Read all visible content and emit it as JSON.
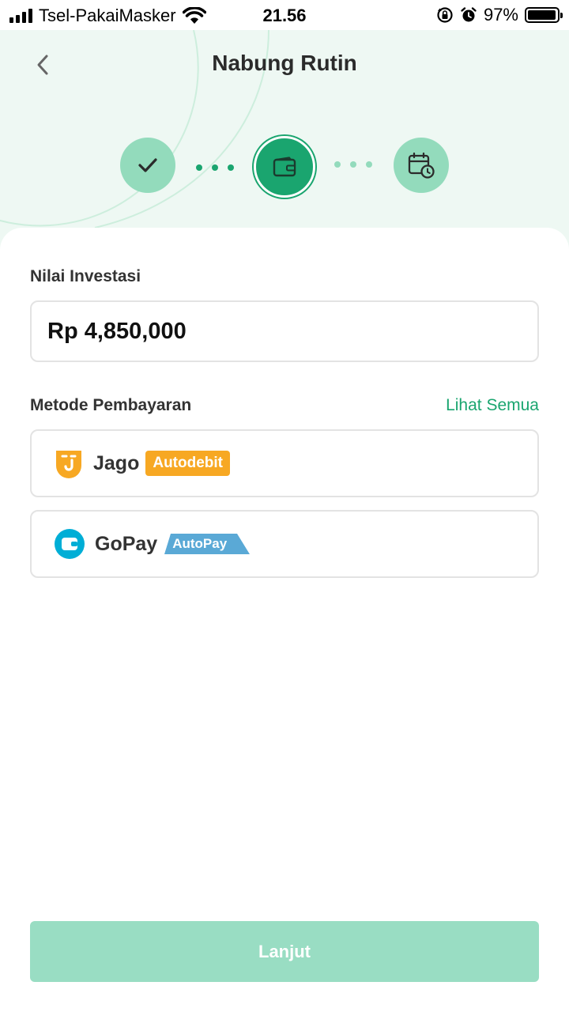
{
  "status_bar": {
    "carrier": "Tsel-PakaiMasker",
    "time": "21.56",
    "battery": "97%",
    "battery_level": 0.97,
    "icons": [
      "signal-icon",
      "wifi-icon",
      "rotation-lock-icon",
      "alarm-icon",
      "battery-icon"
    ]
  },
  "header": {
    "title": "Nabung Rutin",
    "back_icon": "chevron-left-icon"
  },
  "stepper": {
    "steps": [
      {
        "state": "done",
        "icon": "check-icon"
      },
      {
        "state": "active",
        "icon": "wallet-icon"
      },
      {
        "state": "upcoming",
        "icon": "calendar-clock-icon"
      }
    ]
  },
  "investment": {
    "label": "Nilai Investasi",
    "value": "Rp 4,850,000"
  },
  "payment": {
    "label": "Metode Pembayaran",
    "see_all": "Lihat Semua",
    "methods": [
      {
        "name": "Jago",
        "badge": "Autodebit",
        "icon": "jago-logo-icon"
      },
      {
        "name": "GoPay",
        "badge": "AutoPay",
        "icon": "gopay-logo-icon"
      }
    ]
  },
  "cta": {
    "label": "Lanjut"
  },
  "colors": {
    "primary": "#1aa56f",
    "primary_light": "#93dbbc",
    "hero_bg": "#eef8f3",
    "cta_disabled": "#99ddc3",
    "jago_badge": "#f7a823",
    "gopay_badge": "#5aa9d6",
    "gopay_logo": "#00aed6"
  }
}
